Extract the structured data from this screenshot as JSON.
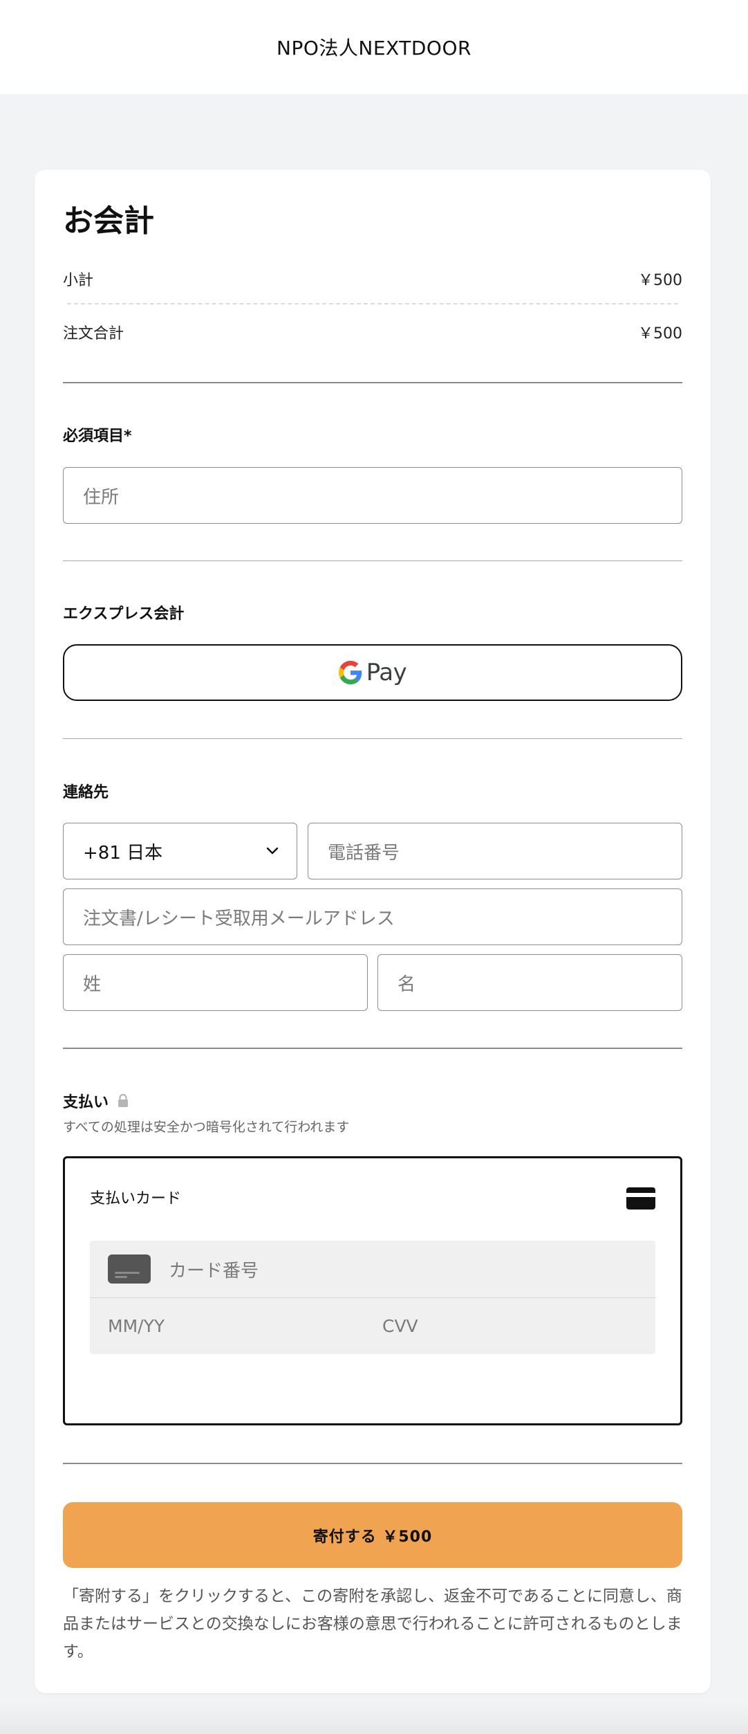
{
  "header": {
    "brand": "NPO法人NEXTDOOR"
  },
  "summary": {
    "title": "お会計",
    "subtotal_label": "小計",
    "subtotal_value": "￥500",
    "total_label": "注文合計",
    "total_value": "￥500"
  },
  "required": {
    "label": "必須項目*",
    "address_placeholder": "住所"
  },
  "express": {
    "label": "エクスプレス会計",
    "gpay_label": "Pay"
  },
  "contact": {
    "label": "連絡先",
    "country_code": "+81 日本",
    "phone_placeholder": "電話番号",
    "email_placeholder": "注文書/レシート受取用メールアドレス",
    "last_name_placeholder": "姓",
    "first_name_placeholder": "名"
  },
  "payment": {
    "label": "支払い",
    "secure_note": "すべての処理は安全かつ暗号化されて行われます",
    "method_label": "支払いカード",
    "card_number_placeholder": "カード番号",
    "expiry_placeholder": "MM/YY",
    "cvv_placeholder": "CVV"
  },
  "action": {
    "donate_label": "寄付する ￥500",
    "disclaimer": "「寄附する」をクリックすると、この寄附を承認し、返金不可であることに同意し、商品またはサービスとの交換なしにお客様の意思で行われることに許可されるものとします。"
  },
  "colors": {
    "accent": "#f0a351",
    "page_bg": "#f2f3f5"
  }
}
